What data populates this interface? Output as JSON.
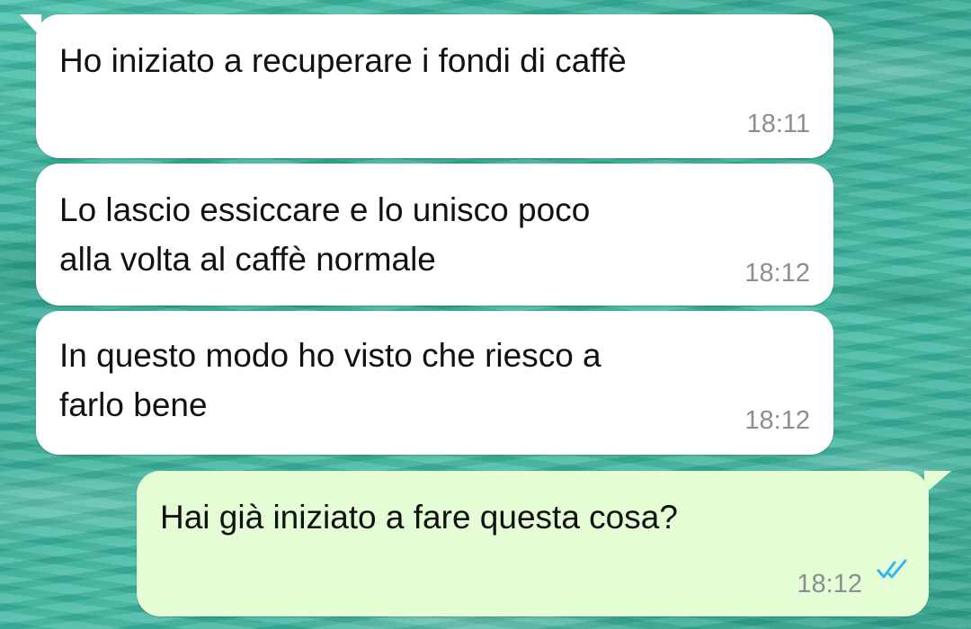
{
  "chat": {
    "messages": [
      {
        "direction": "incoming",
        "text": "Ho iniziato a recuperare i fondi di caffè",
        "time": "18:11"
      },
      {
        "direction": "incoming",
        "text": "Lo lascio essiccare e lo unisco poco\nalla volta al caffè normale",
        "time": "18:12"
      },
      {
        "direction": "incoming",
        "text": "In questo modo ho visto che riesco a\nfarlo bene",
        "time": "18:12"
      },
      {
        "direction": "outgoing",
        "text": "Hai già iniziato a fare questa cosa?",
        "time": "18:12",
        "status": "read"
      }
    ]
  },
  "icons": {
    "read_receipt": "double-check-icon"
  },
  "colors": {
    "incoming_bubble": "#ffffff",
    "outgoing_bubble": "#e5fdd5",
    "timestamp": "#8a8f90",
    "read_ticks": "#34b7f1",
    "wallpaper": "#3fb5a0"
  }
}
